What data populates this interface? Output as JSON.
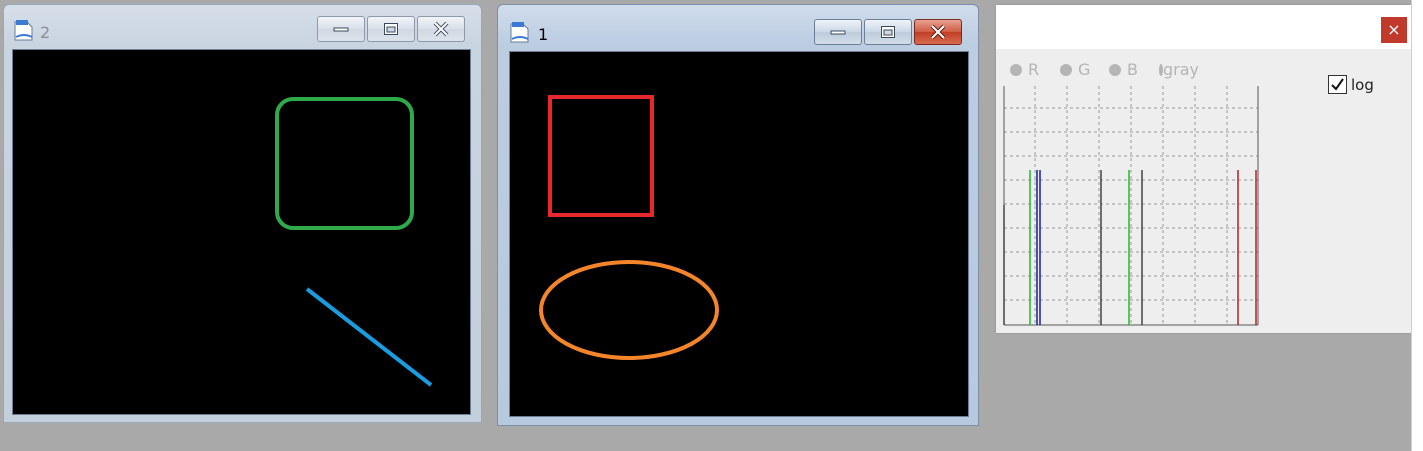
{
  "window2": {
    "title": "2",
    "icon": "document-icon",
    "shapes": {
      "rounded_square_color": "#2faa4a",
      "line_color": "#1a9de0"
    }
  },
  "window1": {
    "title": "1",
    "icon": "document-icon",
    "shapes": {
      "rectangle_color": "#e8282b",
      "ellipse_color": "#f4852b"
    }
  },
  "histogram": {
    "close_label": "×",
    "channels": [
      {
        "label": "R",
        "selected": false
      },
      {
        "label": "G",
        "selected": false
      },
      {
        "label": "B",
        "selected": false
      },
      {
        "label": "gray",
        "selected": false
      }
    ],
    "log_label": "log",
    "log_checked": true,
    "colors": {
      "red": "#b22222",
      "green": "#22bb22",
      "blue": "#1b1b9a",
      "gray": "#444444",
      "close_bg": "#c0392b"
    }
  }
}
